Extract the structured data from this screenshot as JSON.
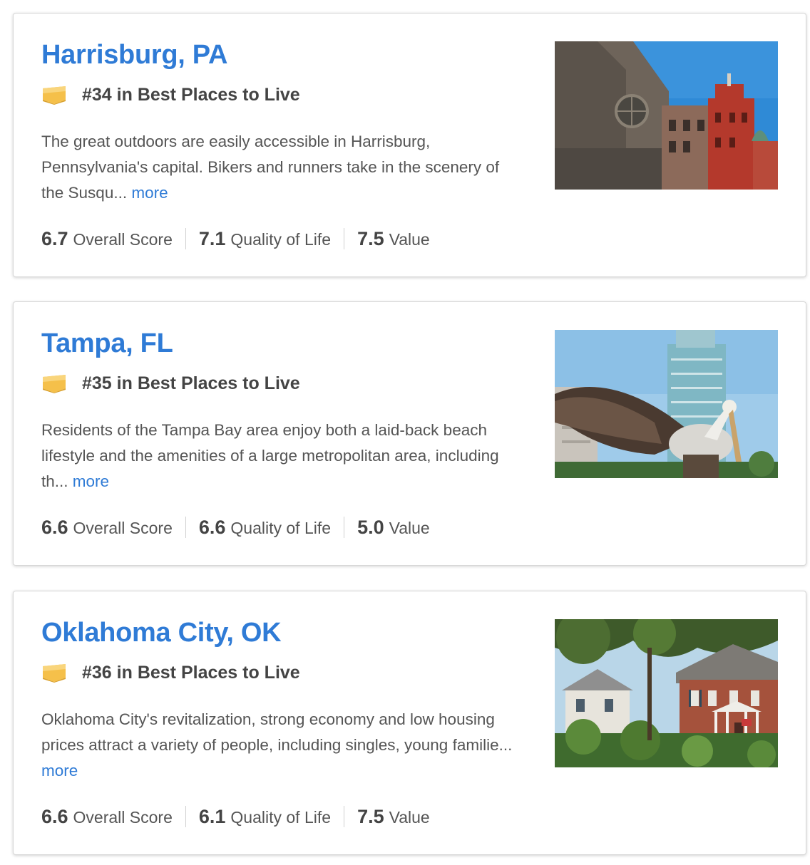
{
  "colors": {
    "link": "#2f7bd6",
    "text": "#555555",
    "badge": "#f5c04a"
  },
  "places": [
    {
      "title": "Harrisburg, PA",
      "rank": "#34 in Best Places to Live",
      "blurb": "The great outdoors are easily accessible in Harrisburg, Pennsylvania's capital. Bikers and runners take in the scenery of the Susqu...",
      "more": "more",
      "overall_score": "6.7",
      "overall_label": "Overall Score",
      "quality_score": "7.1",
      "quality_label": "Quality of Life",
      "value_score": "7.5",
      "value_label": "Value",
      "icon": "badge-icon"
    },
    {
      "title": "Tampa, FL",
      "rank": "#35 in Best Places to Live",
      "blurb": "Residents of the Tampa Bay area enjoy both a laid-back beach lifestyle and the amenities of a large metropolitan area, including th...",
      "more": "more",
      "overall_score": "6.6",
      "overall_label": "Overall Score",
      "quality_score": "6.6",
      "quality_label": "Quality of Life",
      "value_score": "5.0",
      "value_label": "Value",
      "icon": "badge-icon"
    },
    {
      "title": "Oklahoma City, OK",
      "rank": "#36 in Best Places to Live",
      "blurb": "Oklahoma City's revitalization, strong economy and low housing prices attract a variety of people, including singles, young familie...",
      "more": "more",
      "overall_score": "6.6",
      "overall_label": "Overall Score",
      "quality_score": "6.1",
      "quality_label": "Quality of Life",
      "value_score": "7.5",
      "value_label": "Value",
      "icon": "badge-icon"
    }
  ]
}
